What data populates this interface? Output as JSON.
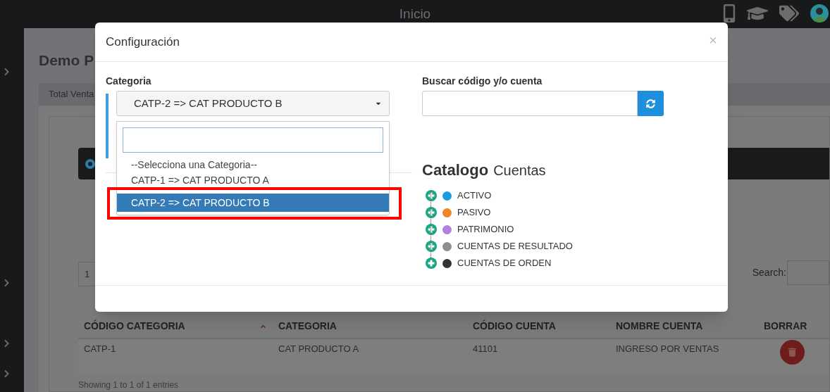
{
  "topbar": {
    "title": "Inicio"
  },
  "background": {
    "page_title": "Demo P",
    "tab": "Total Venta",
    "pagination": "1",
    "search_label": "Search:",
    "table": {
      "columns": [
        {
          "label": "CÓDIGO CATEGORIA",
          "sorted": true
        },
        {
          "label": "CATEGORIA",
          "sorted": false
        },
        {
          "label": "CÓDIGO CUENTA",
          "sorted": false
        },
        {
          "label": "NOMBRE CUENTA",
          "sorted": false
        },
        {
          "label": "BORRAR",
          "sorted": false
        }
      ],
      "rows": [
        {
          "cells": [
            "CATP-1",
            "CAT PRODUCTO A",
            "41101",
            "INGRESO POR VENTAS"
          ]
        }
      ]
    },
    "footer": "Showing 1 to 1 of 1 entries"
  },
  "modal": {
    "title": "Configuración",
    "close": "×",
    "category": {
      "label": "Categoria",
      "value": "CATP-2 => CAT PRODUCTO B",
      "options": [
        {
          "label": "--Selecciona una Categoria--",
          "selected": false
        },
        {
          "label": "CATP-1 => CAT PRODUCTO A",
          "selected": false
        },
        {
          "label": "CATP-2 => CAT PRODUCTO B",
          "selected": true
        }
      ]
    },
    "search": {
      "label": "Buscar código y/o cuenta"
    },
    "catalog": {
      "title_bold": "Catalogo",
      "title_rest": "Cuentas",
      "items": [
        {
          "label": "ACTIVO",
          "color": "#1a9ee0"
        },
        {
          "label": "PASIVO",
          "color": "#ef8523"
        },
        {
          "label": "PATRIMONIO",
          "color": "#b47fe0"
        },
        {
          "label": "CUENTAS DE RESULTADO",
          "color": "#8f8f8f"
        },
        {
          "label": "CUENTAS DE ORDEN",
          "color": "#333333"
        }
      ]
    }
  }
}
